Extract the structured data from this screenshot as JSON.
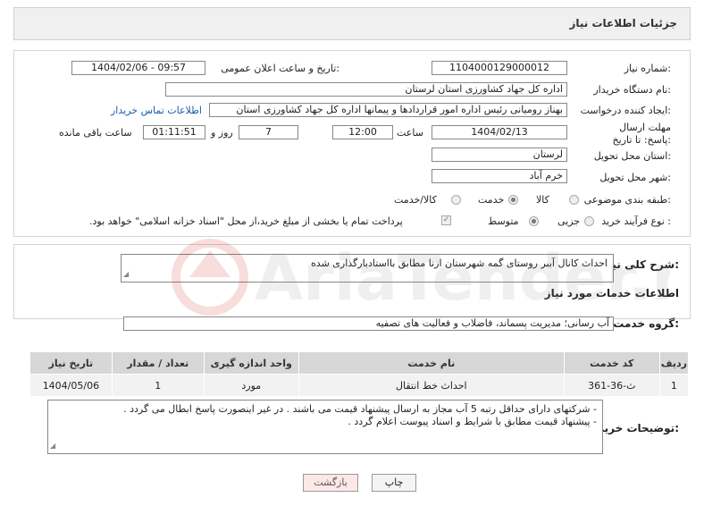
{
  "header": {
    "title": "جزئیات اطلاعات نیاز"
  },
  "form": {
    "need_number_label": "شماره نیاز:",
    "need_number": "1104000129000012",
    "announce_label": "تاریخ و ساعت اعلان عمومی:",
    "announce_value": "1404/02/06 - 09:57",
    "buyer_org_label": "نام دستگاه خریدار:",
    "buyer_org": "اداره کل جهاد کشاورزی استان لرستان",
    "creator_label": "ایجاد کننده درخواست:",
    "creator": "بهناز رومیانی رئیس اداره امور قراردادها و پیمانها اداره کل جهاد کشاورزی استان",
    "buyer_contact_link": "اطلاعات تماس خریدار",
    "deadline_label": "مهلت ارسال پاسخ: تا تاریخ:",
    "deadline_date": "1404/02/13",
    "time_label": "ساعت",
    "deadline_time": "12:00",
    "days_value": "7",
    "days_label": "روز و",
    "remaining_time": "01:11:51",
    "remaining_label": "ساعت باقی مانده",
    "province_label": "استان محل تحویل:",
    "province": "لرستان",
    "city_label": "شهر محل تحویل:",
    "city": "خرم آباد",
    "category_label": "طبقه بندی موضوعی:",
    "category_options": [
      "کالا",
      "خدمت",
      "کالا/خدمت"
    ],
    "category_selected": "خدمت",
    "process_label": "نوع فرآیند خرید :",
    "process_options": [
      "جزیی",
      "متوسط"
    ],
    "process_selected": "متوسط",
    "payment_note": "پرداخت تمام یا بخشی از مبلغ خرید،از محل \"اسناد خزانه اسلامی\" خواهد بود."
  },
  "summary": {
    "label": "شرح کلی نیاز:",
    "text": "احداث کانال آببر روستای گمه شهرستان ازنا مطابق بااستادبارگذاری شده"
  },
  "services": {
    "section_title": "اطلاعات خدمات مورد نیاز",
    "group_label": "گروه خدمت:",
    "group_value": "آب رسانی؛ مدیریت پسماند، فاضلاب و فعالیت های تصفیه",
    "columns": [
      "ردیف",
      "کد خدمت",
      "نام خدمت",
      "واحد اندازه گیری",
      "تعداد / مقدار",
      "تاریخ نیاز"
    ],
    "rows": [
      {
        "row": "1",
        "code": "ث-36-361",
        "name": "احداث خط انتقال",
        "unit": "مورد",
        "qty": "1",
        "date": "1404/05/06"
      }
    ]
  },
  "notes": {
    "label": "توضیحات خریدار:",
    "line1": "- شرکتهای دارای حداقل رتبه 5 آب مجاز به ارسال پیشنهاد قیمت می باشند . در غیر اینصورت پاسخ ابطال می گردد .",
    "line2": "- پیشنهاد قیمت مطابق با شرایط و اسناد پیوست اعلام گردد ."
  },
  "buttons": {
    "print": "چاپ",
    "back": "بازگشت"
  },
  "watermark_text": "AriaTender.net"
}
